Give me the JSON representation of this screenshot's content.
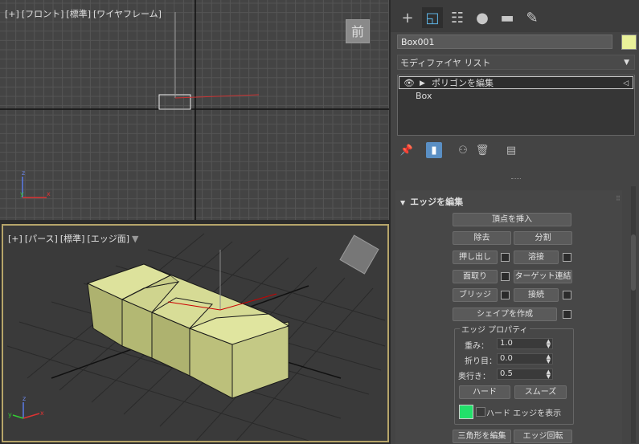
{
  "viewports": {
    "front": {
      "labels": [
        "[+]",
        "[フロント]",
        "[標準]",
        "[ワイヤフレーム]"
      ],
      "viewcube": "前"
    },
    "persp": {
      "labels": [
        "[+]",
        "[パース]",
        "[標準]",
        "[エッジ面]"
      ]
    }
  },
  "panel": {
    "tabs": [
      "create-icon",
      "modify-icon",
      "hierarchy-icon",
      "motion-icon",
      "display-icon",
      "utilities-icon"
    ],
    "object_name": "Box001",
    "object_color": "#e9f19a",
    "modifier_list": "モディファイヤ リスト",
    "stack": {
      "top": "ポリゴンを編集",
      "base": "Box"
    },
    "rollout": {
      "title": "エッジを編集",
      "insert_vertex": "頂点を挿入",
      "remove": "除去",
      "split": "分割",
      "extrude": "押し出し",
      "weld": "溶接",
      "chamfer": "面取り",
      "target_weld": "ターゲット連結",
      "bridge": "ブリッジ",
      "connect": "接続",
      "create_shape": "シェイプを作成",
      "edge_props": {
        "title": "エッジ プロパティ",
        "weight_label": "重み：",
        "weight": "1.0",
        "crease_label": "折り目：",
        "crease": "0.0",
        "depth_label": "奥行き：",
        "depth": "0.5",
        "hard": "ハード",
        "smooth": "スムーズ",
        "show_hard": "ハード エッジを表示",
        "hard_color": "#22e06a"
      },
      "edit_tri": "三角形を編集",
      "turn": "エッジ回転"
    }
  }
}
